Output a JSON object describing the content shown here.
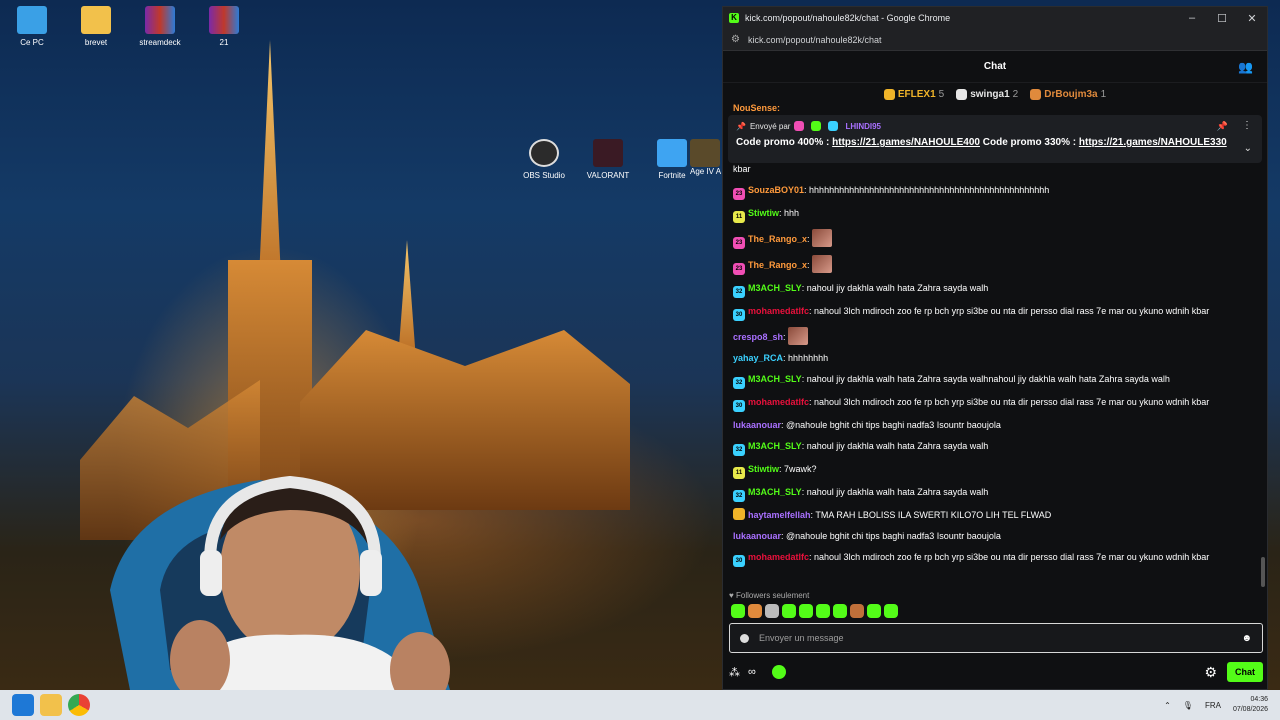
{
  "desktop": {
    "icons": [
      {
        "label": "Ce PC"
      },
      {
        "label": "brevet"
      },
      {
        "label": "streamdeck"
      },
      {
        "label": "21"
      },
      {
        "label": "OBS Studio"
      },
      {
        "label": "VALORANT"
      },
      {
        "label": "Fortnite"
      },
      {
        "label": "Age IV A"
      }
    ]
  },
  "window": {
    "title": "kick.com/popout/nahoule82k/chat - Google Chrome",
    "url": "kick.com/popout/nahoule82k/chat",
    "controls": {
      "minimize": "–",
      "maximize": "☐",
      "close": "✕"
    }
  },
  "chat": {
    "header": "Chat",
    "leaderboard": [
      {
        "name": "EFLEX1",
        "count": "5",
        "color": "#f0b429"
      },
      {
        "name": "swinga1",
        "count": "2",
        "color": "#e6e6e6"
      },
      {
        "name": "DrBoujm3a",
        "count": "1",
        "color": "#e08a3c"
      }
    ],
    "pinned": {
      "sent_by_label": "Envoyé par",
      "sender": "LHINDI95",
      "text_1": "Code promo 400% :",
      "link_1": "https://21.games/NAHOULE400",
      "text_2": "Code promo 330% :",
      "link_2": "https://21.games/NAHOULE330"
    },
    "partial_top": "NouSense:",
    "partial_text": "kbar",
    "messages": [
      {
        "user": "SouzaBOY01",
        "color": "#ff9a3c",
        "text": "hhhhhhhhhhhhhhhhhhhhhhhhhhhhhhhhhhhhhhhhhhhhhhhh",
        "badge": "#f04eb4",
        "badge_text": "23"
      },
      {
        "user": "Stiwtiw",
        "color": "#53fc18",
        "text": "hhh",
        "badge": "#e7e94b",
        "badge_text": "11"
      },
      {
        "user": "The_Rango_x",
        "color": "#ff9a3c",
        "text": "",
        "badge": "#f04eb4",
        "badge_text": "23",
        "emote": true
      },
      {
        "user": "The_Rango_x",
        "color": "#ff9a3c",
        "text": "",
        "badge": "#f04eb4",
        "badge_text": "23",
        "emote": true
      },
      {
        "user": "M3ACH_SLY",
        "color": "#53fc18",
        "text": "nahoul jiy dakhla walh hata Zahra sayda walh",
        "badge": "#3ad1ff",
        "badge_text": "32"
      },
      {
        "user": "mohamedatlfc",
        "color": "#e9113c",
        "text": "nahoul 3lch mdiroch zoo fe rp bch yrp si3be ou nta dir persso dial rass 7e mar ou ykuno wdnih kbar",
        "badge": "#3ad1ff",
        "badge_text": "30"
      },
      {
        "user": "crespo8_sh",
        "color": "#a970ff",
        "text": "",
        "badge": "",
        "badge_text": "",
        "emote": true
      },
      {
        "user": "yahay_RCA",
        "color": "#3ad1ff",
        "text": "hhhhhhhh",
        "badge": "",
        "badge_text": ""
      },
      {
        "user": "M3ACH_SLY",
        "color": "#53fc18",
        "text": "nahoul jiy dakhla walh hata Zahra sayda walhnahoul jiy dakhla walh hata Zahra sayda walh",
        "badge": "#3ad1ff",
        "badge_text": "32"
      },
      {
        "user": "mohamedatlfc",
        "color": "#e9113c",
        "text": "nahoul 3lch mdiroch zoo fe rp bch yrp si3be ou nta dir persso dial rass 7e mar ou ykuno wdnih kbar",
        "badge": "#3ad1ff",
        "badge_text": "30"
      },
      {
        "user": "lukaanouar",
        "color": "#a970ff",
        "text": "@nahoule bghit chi tips baghi nadfa3 Isountr baoujola",
        "badge": "",
        "badge_text": ""
      },
      {
        "user": "M3ACH_SLY",
        "color": "#53fc18",
        "text": "nahoul jiy dakhla walh hata Zahra sayda walh",
        "badge": "#3ad1ff",
        "badge_text": "32"
      },
      {
        "user": "Stiwtiw",
        "color": "#53fc18",
        "text": "7wawk?",
        "badge": "#e7e94b",
        "badge_text": "11"
      },
      {
        "user": "M3ACH_SLY",
        "color": "#53fc18",
        "text": "nahoul jiy dakhla walh hata Zahra sayda walh",
        "badge": "#3ad1ff",
        "badge_text": "32"
      },
      {
        "user": "haytamelfellah",
        "color": "#a970ff",
        "text": "TMA RAH LBOLISS ILA SWERTI KILO7O LIH TEL FLWAD",
        "badge": "#f0b429",
        "badge_text": ""
      },
      {
        "user": "lukaanouar",
        "color": "#a970ff",
        "text": "@nahoule bghit chi tips baghi nadfa3 Isountr baoujola",
        "badge": "",
        "badge_text": ""
      },
      {
        "user": "mohamedatlfc",
        "color": "#e9113c",
        "text": "nahoul 3lch mdiroch zoo fe rp bch yrp si3be ou nta dir persso dial rass 7e mar ou ykuno wdnih kbar",
        "badge": "#3ad1ff",
        "badge_text": "30"
      }
    ],
    "followers_only": "Followers seulement",
    "input_placeholder": "Envoyer un message",
    "send_button": "Chat"
  },
  "taskbar": {
    "lang": "FRA",
    "time": "04:36",
    "date": "07/08/2026"
  }
}
